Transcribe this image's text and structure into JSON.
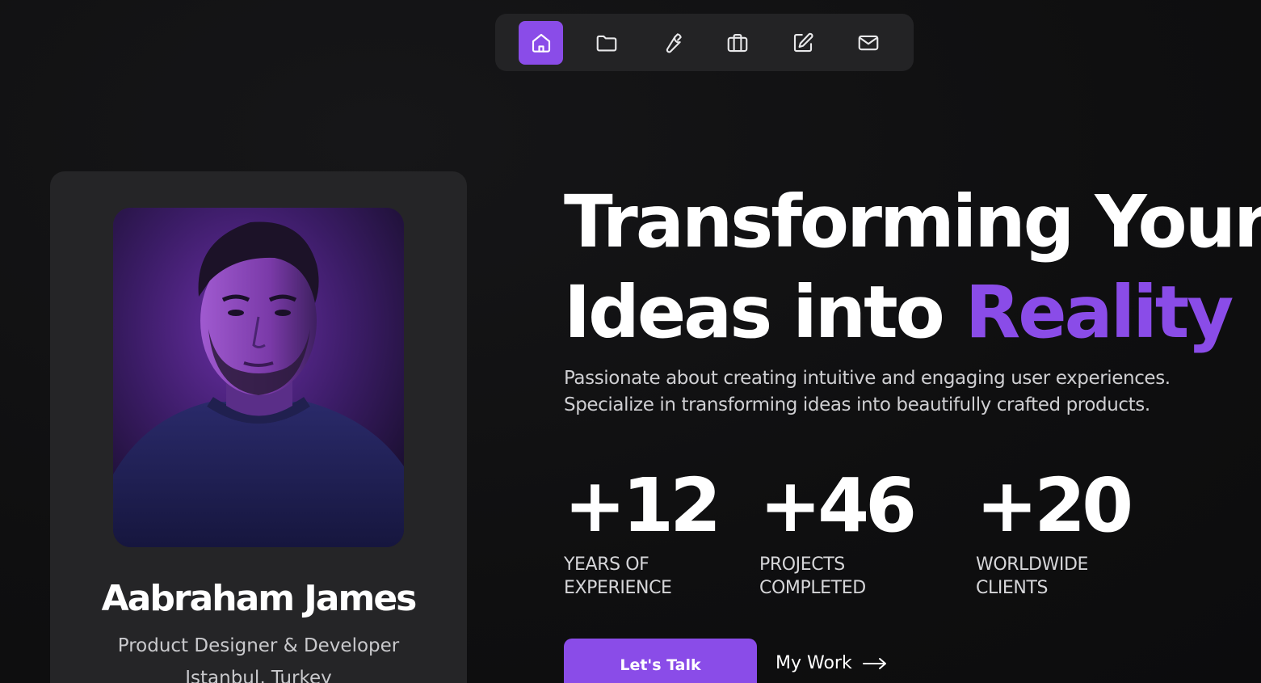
{
  "nav": {
    "items": [
      {
        "icon": "home-icon",
        "active": true
      },
      {
        "icon": "folder-icon",
        "active": false
      },
      {
        "icon": "wrench-icon",
        "active": false
      },
      {
        "icon": "briefcase-icon",
        "active": false
      },
      {
        "icon": "edit-icon",
        "active": false
      },
      {
        "icon": "mail-icon",
        "active": false
      }
    ]
  },
  "profile": {
    "name": "Aabraham James",
    "role": "Product Designer & Developer",
    "location": "Istanbul, Turkey"
  },
  "hero": {
    "title_line1": "Transforming Your",
    "title_line2_prefix": "Ideas into ",
    "title_line2_accent": "Reality",
    "subtitle_line1": "Passionate about creating intuitive and engaging user experiences.",
    "subtitle_line2": "Specialize in transforming ideas into beautifully crafted products."
  },
  "stats": [
    {
      "value": "+12",
      "label_line1": "YEARS OF",
      "label_line2": "EXPERIENCE"
    },
    {
      "value": "+46",
      "label_line1": "PROJECTS",
      "label_line2": "COMPLETED"
    },
    {
      "value": "+20",
      "label_line1": "WORLDWIDE",
      "label_line2": "CLIENTS"
    }
  ],
  "actions": {
    "primary_label": "Let's Talk",
    "secondary_label": "My Work"
  },
  "colors": {
    "accent": "#8a4ce8",
    "background": "#101011",
    "card": "#252527"
  }
}
